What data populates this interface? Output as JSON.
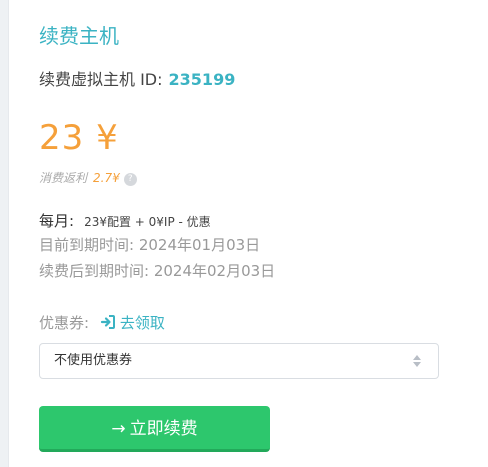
{
  "title": "续费主机",
  "host": {
    "label": "续费虚拟主机 ID:",
    "id": "235199"
  },
  "price": "23 ¥",
  "rebate": {
    "label": "消费返利",
    "amount": "2.7¥",
    "help": "?"
  },
  "monthly": {
    "label": "每月:",
    "detail": "23¥配置 + 0¥IP - 优惠"
  },
  "expiry": {
    "current": "目前到期时间: 2024年01月03日",
    "after": "续费后到期时间: 2024年02月03日"
  },
  "coupon": {
    "label": "优惠券:",
    "claim": "去领取",
    "selected": "不使用优惠券"
  },
  "renew_button": "立即续费",
  "colors": {
    "accent": "#3bb3c3",
    "price": "#f5a03a",
    "button": "#2dc76d"
  }
}
